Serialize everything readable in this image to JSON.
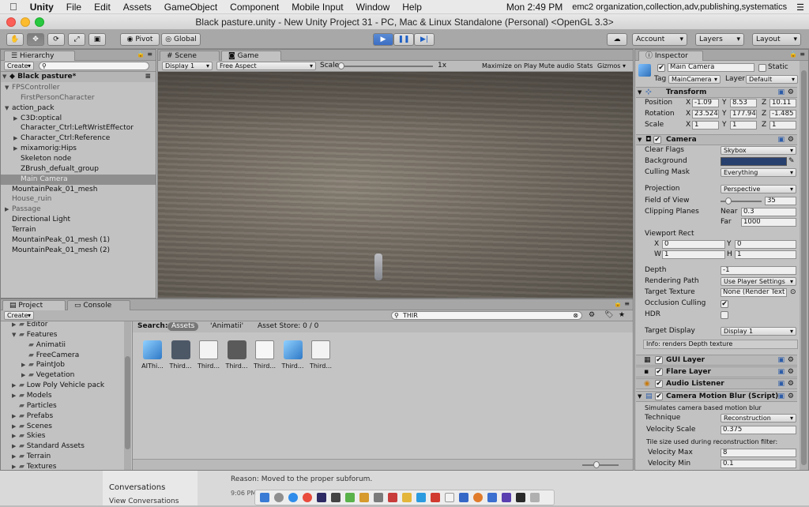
{
  "menubar": {
    "apple": "",
    "app": "Unity",
    "items": [
      "File",
      "Edit",
      "Assets",
      "GameObject",
      "Component",
      "Mobile Input",
      "Window",
      "Help"
    ],
    "clock": "Mon 2:49 PM",
    "user": "emc2 organization,collection,adv,publishing,systematics"
  },
  "window": {
    "title": "Black pasture.unity - New Unity Project 31 - PC, Mac & Linux Standalone (Personal) <OpenGL 3.3>"
  },
  "toolbar": {
    "pivot": "Pivot",
    "global": "Global",
    "account": "Account",
    "layers": "Layers",
    "layout": "Layout",
    "play_icon": "play-icon",
    "pause_icon": "pause-icon",
    "step_icon": "step-icon",
    "cloud_icon": "cloud-icon"
  },
  "hierarchy": {
    "tab": "Hierarchy",
    "create": "Create",
    "scene": "Black pasture*",
    "items": [
      {
        "label": "FPSController",
        "indent": 1,
        "tri": "▼",
        "gray": true
      },
      {
        "label": "FirstPersonCharacter",
        "indent": 2,
        "tri": "",
        "gray": true
      },
      {
        "label": "action_pack",
        "indent": 1,
        "tri": "▼",
        "gray": false
      },
      {
        "label": "C3D:optical",
        "indent": 2,
        "tri": "▶",
        "gray": false
      },
      {
        "label": "Character_Ctrl:LeftWristEffector",
        "indent": 2,
        "tri": "",
        "gray": false
      },
      {
        "label": "Character_Ctrl:Reference",
        "indent": 2,
        "tri": "▶",
        "gray": false
      },
      {
        "label": "mixamorig:Hips",
        "indent": 2,
        "tri": "▶",
        "gray": false
      },
      {
        "label": "Skeleton node",
        "indent": 2,
        "tri": "",
        "gray": false
      },
      {
        "label": "ZBrush_defualt_group",
        "indent": 2,
        "tri": "",
        "gray": false
      },
      {
        "label": "Main Camera",
        "indent": 2,
        "tri": "",
        "gray": false,
        "selected": true
      },
      {
        "label": "MountainPeak_01_mesh",
        "indent": 1,
        "tri": "",
        "gray": false
      },
      {
        "label": "House_ruin",
        "indent": 1,
        "tri": "",
        "gray": true
      },
      {
        "label": "Passage",
        "indent": 1,
        "tri": "▶",
        "gray": true
      },
      {
        "label": "Directional Light",
        "indent": 1,
        "tri": "",
        "gray": false
      },
      {
        "label": "Terrain",
        "indent": 1,
        "tri": "",
        "gray": false
      },
      {
        "label": "MountainPeak_01_mesh (1)",
        "indent": 1,
        "tri": "",
        "gray": false
      },
      {
        "label": "MountainPeak_01_mesh (2)",
        "indent": 1,
        "tri": "",
        "gray": false
      }
    ]
  },
  "game": {
    "tab_scene": "Scene",
    "tab_game": "Game",
    "display": "Display 1",
    "aspect": "Free Aspect",
    "scale_label": "Scale",
    "scale_value": "1x",
    "maximize": "Maximize on Play",
    "mute": "Mute audio",
    "stats": "Stats",
    "gizmos": "Gizmos"
  },
  "project": {
    "tab": "Project",
    "tab_console": "Console",
    "create": "Create",
    "search_value": "THIR",
    "search_label": "Search:",
    "filter_assets": "Assets",
    "filter_anim": "'Animatii'",
    "asset_store": "Asset Store: 0 / 0",
    "folders": [
      {
        "label": "Editor",
        "indent": 1,
        "tri": "▶"
      },
      {
        "label": "Features",
        "indent": 1,
        "tri": "▼"
      },
      {
        "label": "Animatii",
        "indent": 2,
        "tri": ""
      },
      {
        "label": "FreeCamera",
        "indent": 2,
        "tri": ""
      },
      {
        "label": "PaintJob",
        "indent": 2,
        "tri": "▶"
      },
      {
        "label": "Vegetation",
        "indent": 2,
        "tri": "▶"
      },
      {
        "label": "Low Poly Vehicle pack",
        "indent": 1,
        "tri": "▶"
      },
      {
        "label": "Models",
        "indent": 1,
        "tri": "▶"
      },
      {
        "label": "Particles",
        "indent": 1,
        "tri": ""
      },
      {
        "label": "Prefabs",
        "indent": 1,
        "tri": "▶"
      },
      {
        "label": "Scenes",
        "indent": 1,
        "tri": "▶"
      },
      {
        "label": "Skies",
        "indent": 1,
        "tri": "▶"
      },
      {
        "label": "Standard Assets",
        "indent": 1,
        "tri": "▶"
      },
      {
        "label": "Terrain",
        "indent": 1,
        "tri": "▶"
      },
      {
        "label": "Textures",
        "indent": 1,
        "tri": "▶"
      }
    ],
    "assets": [
      {
        "label": "AIThi...",
        "icon": "prefab-cube-icon"
      },
      {
        "label": "Third...",
        "icon": "animator-icon"
      },
      {
        "label": "Third...",
        "icon": "csharp-script-icon"
      },
      {
        "label": "Third...",
        "icon": "folder-icon"
      },
      {
        "label": "Third...",
        "icon": "document-icon"
      },
      {
        "label": "Third...",
        "icon": "prefab-cube-icon"
      },
      {
        "label": "Third...",
        "icon": "csharp-script-icon"
      }
    ]
  },
  "inspector": {
    "tab": "Inspector",
    "name": "Main Camera",
    "static": "Static",
    "tag_label": "Tag",
    "tag": "MainCamera",
    "layer_label": "Layer",
    "layer": "Default",
    "transform": {
      "title": "Transform",
      "position": {
        "label": "Position",
        "x": "-1.09",
        "y": "8.53",
        "z": "10.11"
      },
      "rotation": {
        "label": "Rotation",
        "x": "23.524",
        "y": "177.94",
        "z": "-1.485"
      },
      "scale": {
        "label": "Scale",
        "x": "1",
        "y": "1",
        "z": "1"
      }
    },
    "camera": {
      "title": "Camera",
      "clear_flags_label": "Clear Flags",
      "clear_flags": "Skybox",
      "background_label": "Background",
      "culling_label": "Culling Mask",
      "culling": "Everything",
      "projection_label": "Projection",
      "projection": "Perspective",
      "fov_label": "Field of View",
      "fov": "35",
      "clipping_label": "Clipping Planes",
      "near_label": "Near",
      "near": "0.3",
      "far_label": "Far",
      "far": "1000",
      "viewport_label": "Viewport Rect",
      "vx": "0",
      "vy": "0",
      "vw": "1",
      "vh": "1",
      "depth_label": "Depth",
      "depth": "-1",
      "rendering_label": "Rendering Path",
      "rendering": "Use Player Settings",
      "target_label": "Target Texture",
      "target": "None (Render Text",
      "occlusion_label": "Occlusion Culling",
      "hdr_label": "HDR",
      "display_label": "Target Display",
      "display": "Display 1",
      "info": "Info: renders Depth texture",
      "background_color": "#27406e"
    },
    "gui_layer": "GUI Layer",
    "flare_layer": "Flare Layer",
    "audio_listener": "Audio Listener",
    "motion_blur": {
      "title": "Camera Motion Blur (Script)",
      "desc": "Simulates camera based motion blur",
      "technique_label": "Technique",
      "technique": "Reconstruction",
      "velocity_scale_label": "Velocity Scale",
      "velocity_scale": "0.375",
      "tile_note": "Tile size used during reconstruction filter:",
      "velocity_max_label": "Velocity Max",
      "velocity_max": "8",
      "velocity_min_label": "Velocity Min",
      "velocity_min": "0.1"
    }
  },
  "background_app": {
    "item1": "Conversations",
    "item2": "View Conversations",
    "time": "9:06 PM",
    "reason": "Reason: Moved to the proper subforum."
  }
}
